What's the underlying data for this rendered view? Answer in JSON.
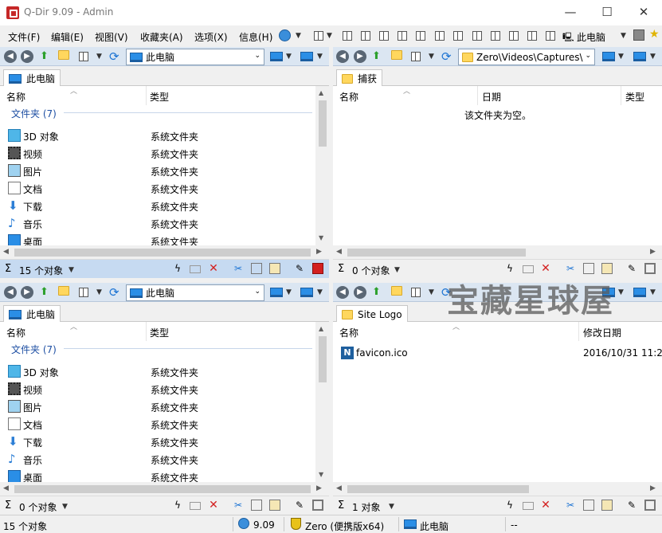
{
  "window": {
    "title": "Q-Dir 9.09 - Admin",
    "minimize_glyph": "—",
    "maximize_glyph": "☐",
    "close_glyph": "✕"
  },
  "menu": {
    "items": [
      "文件(F)",
      "编辑(E)",
      "视图(V)",
      "收藏夹(A)",
      "选项(X)",
      "信息(H)"
    ],
    "this_pc": "此电脑"
  },
  "panes": {
    "top_left": {
      "address": "此电脑",
      "tab": "此电脑",
      "columns": [
        "名称",
        "类型"
      ],
      "group": "文件夹 (7)",
      "rows": [
        {
          "name": "3D 对象",
          "type": "系统文件夹",
          "icon": "cube-3d-icon"
        },
        {
          "name": "视频",
          "type": "系统文件夹",
          "icon": "video-icon"
        },
        {
          "name": "图片",
          "type": "系统文件夹",
          "icon": "picture-icon"
        },
        {
          "name": "文档",
          "type": "系统文件夹",
          "icon": "document-icon"
        },
        {
          "name": "下载",
          "type": "系统文件夹",
          "icon": "download-icon"
        },
        {
          "name": "音乐",
          "type": "系统文件夹",
          "icon": "music-icon"
        },
        {
          "name": "桌面",
          "type": "系统文件夹",
          "icon": "desktop-icon"
        }
      ],
      "status": "15 个对象"
    },
    "top_right": {
      "address": "Zero\\Videos\\Captures\\",
      "tab": "捕获",
      "columns": [
        "名称",
        "日期",
        "类型"
      ],
      "empty": "该文件夹为空。",
      "status": "0 个对象"
    },
    "bottom_left": {
      "address": "此电脑",
      "tab": "此电脑",
      "columns": [
        "名称",
        "类型"
      ],
      "group": "文件夹 (7)",
      "rows": [
        {
          "name": "3D 对象",
          "type": "系统文件夹",
          "icon": "cube-3d-icon"
        },
        {
          "name": "视频",
          "type": "系统文件夹",
          "icon": "video-icon"
        },
        {
          "name": "图片",
          "type": "系统文件夹",
          "icon": "picture-icon"
        },
        {
          "name": "文档",
          "type": "系统文件夹",
          "icon": "document-icon"
        },
        {
          "name": "下载",
          "type": "系统文件夹",
          "icon": "download-icon"
        },
        {
          "name": "音乐",
          "type": "系统文件夹",
          "icon": "music-icon"
        },
        {
          "name": "桌面",
          "type": "系统文件夹",
          "icon": "desktop-icon"
        }
      ],
      "status": "0 个对象"
    },
    "bottom_right": {
      "tab": "Site Logo",
      "columns": [
        "名称",
        "修改日期"
      ],
      "rows": [
        {
          "name": "favicon.ico",
          "date": "2016/10/31 11:2",
          "icon": "favicon-icon"
        }
      ],
      "status": "1 对象"
    }
  },
  "bottom_status": {
    "count": "15 个对象",
    "version": "9.09",
    "user": "Zero (便携版x64)",
    "location": "此电脑",
    "extra": "--"
  },
  "watermark": "宝藏星球屋",
  "colors": {
    "active_status": "#c6daf1",
    "nav_bar": "#dbe6f2",
    "group_header": "#1e4fa3",
    "delete_red": "#d32020"
  }
}
